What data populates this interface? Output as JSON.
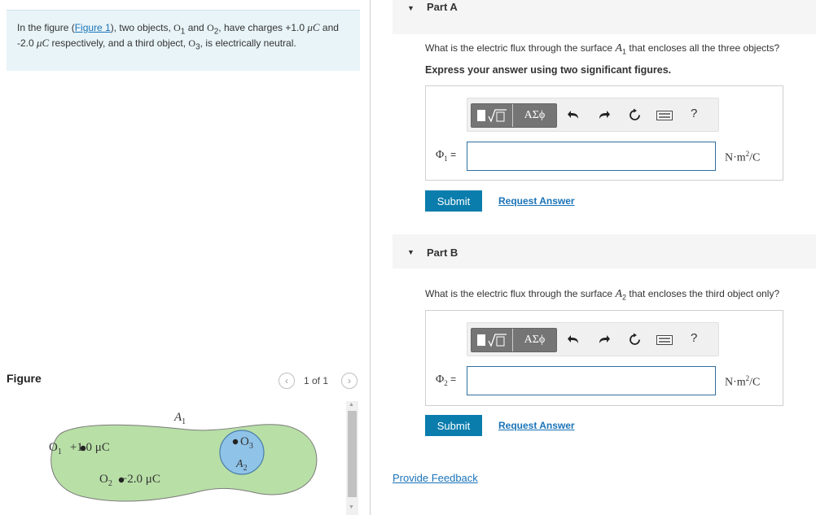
{
  "intro": {
    "prefix": "In the figure (",
    "figure_link": "Figure 1",
    "text_a": "), two objects, ",
    "o1": "O",
    "o1_sub": "1",
    "and": " and ",
    "o2": "O",
    "o2_sub": "2",
    "text_b": ", have charges +1.0 ",
    "mu1": "μC",
    "text_c": " and -2.0 ",
    "mu2": "μC",
    "text_d": " respectively, and a third object, ",
    "o3": "O",
    "o3_sub": "3",
    "text_e": ", is electrically neutral."
  },
  "figure": {
    "label": "Figure",
    "pager": "1 of 1",
    "prev_icon": "chevron-left-icon",
    "next_icon": "chevron-right-icon",
    "diagram": {
      "surface_a1": "A",
      "surface_a1_sub": "1",
      "surface_a2": "A",
      "surface_a2_sub": "2",
      "obj1": "O",
      "obj1_sub": "1",
      "obj1_charge": "+1.0 μC",
      "obj2": "O",
      "obj2_sub": "2",
      "obj2_charge": "−2.0 μC",
      "obj3": "O",
      "obj3_sub": "3",
      "fill_color": "#b8dfa6",
      "sphere_color": "#8fc3e8"
    }
  },
  "parts": [
    {
      "title": "Part A",
      "question_pre": "What is the electric flux through the surface ",
      "surface": "A",
      "surface_sub": "1",
      "question_post": " that encloses all the three objects?",
      "instruction": "Express your answer using two significant figures.",
      "answer_symbol": "Φ",
      "answer_sub": "1",
      "answer_eq": " =",
      "answer_value": "",
      "unit": "N·m",
      "unit_sup": "2",
      "unit_tail": "/C",
      "submit": "Submit",
      "request": "Request Answer"
    },
    {
      "title": "Part B",
      "question_pre": "What is the electric flux through the surface ",
      "surface": "A",
      "surface_sub": "2",
      "question_post": " that encloses the third object only?",
      "instruction": "",
      "answer_symbol": "Φ",
      "answer_sub": "2",
      "answer_eq": " =",
      "answer_value": "",
      "unit": "N·m",
      "unit_sup": "2",
      "unit_tail": "/C",
      "submit": "Submit",
      "request": "Request Answer"
    }
  ],
  "toolbar": {
    "symbols_label": "ΑΣϕ",
    "help_label": "?",
    "icons": [
      "templates-icon",
      "undo-icon",
      "redo-icon",
      "reset-icon",
      "keyboard-icon",
      "help-icon"
    ]
  },
  "feedback": "Provide Feedback",
  "colors": {
    "accent": "#0a7dad",
    "link": "#1a73b8",
    "intro_bg": "#e8f4f8"
  }
}
